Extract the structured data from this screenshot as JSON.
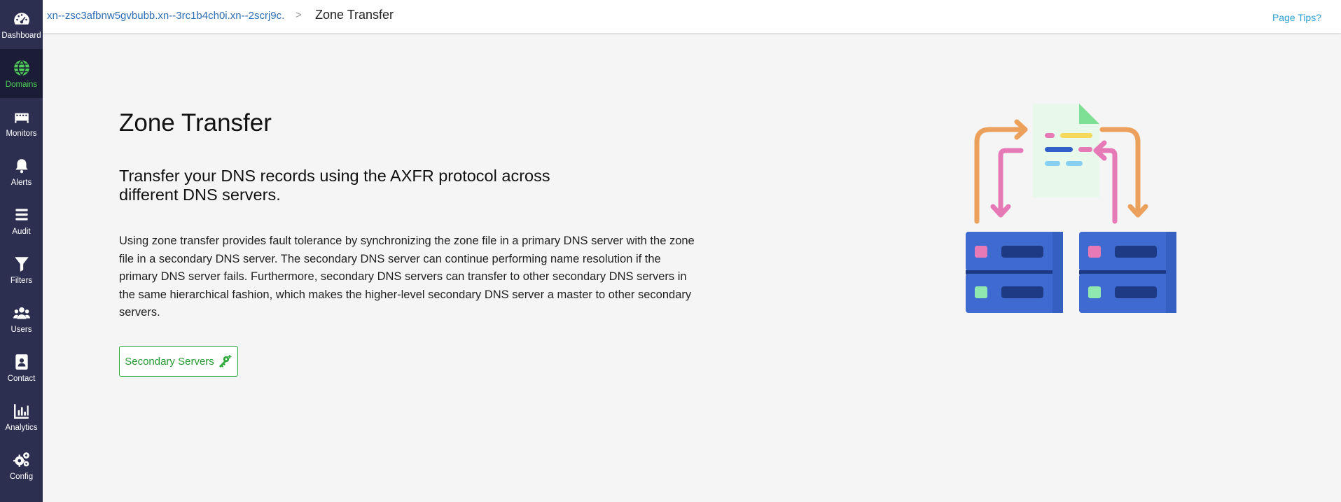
{
  "sidebar": {
    "items": [
      {
        "label": "Dashboard",
        "icon": "speedometer-icon",
        "active": false
      },
      {
        "label": "Domains",
        "icon": "globe-icon",
        "active": true
      },
      {
        "label": "Monitors",
        "icon": "monitor-icon",
        "active": false
      },
      {
        "label": "Alerts",
        "icon": "bell-icon",
        "active": false
      },
      {
        "label": "Audit",
        "icon": "audit-list-icon",
        "active": false
      },
      {
        "label": "Filters",
        "icon": "filter-icon",
        "active": false
      },
      {
        "label": "Users",
        "icon": "users-icon",
        "active": false
      },
      {
        "label": "Contact",
        "icon": "contact-card-icon",
        "active": false
      },
      {
        "label": "Analytics",
        "icon": "bar-chart-icon",
        "active": false
      },
      {
        "label": "Config",
        "icon": "gears-icon",
        "active": false
      }
    ]
  },
  "header": {
    "breadcrumb_domain": "xn--zsc3afbnw5gvbubb.xn--3rc1b4ch0i.xn--2scrj9c.",
    "breadcrumb_separator": ">",
    "breadcrumb_current": "Zone Transfer",
    "page_tips": "Page Tips?"
  },
  "main": {
    "title": "Zone Transfer",
    "subtitle": "Transfer your DNS records using the AXFR protocol across different DNS servers.",
    "description": "Using zone transfer provides fault tolerance by synchronizing the zone file in a primary DNS server with the zone file in a secondary DNS server. The secondary DNS server can continue performing name resolution if the primary DNS server fails. Furthermore, secondary DNS servers can transfer to other secondary DNS servers in the same hierarchical fashion, which makes the higher-level secondary DNS server a master to other secondary servers.",
    "button_label": "Secondary Servers",
    "button_icon": "key-plus-icon",
    "illustration": "zone-transfer-illustration"
  },
  "colors": {
    "sidebar_bg": "#2d2f50",
    "sidebar_active_bg": "#1b1c35",
    "active_accent": "#4fd05a",
    "link": "#2e6fb7",
    "page_tips": "#2a9fd6",
    "button_green": "#2eaa3a"
  }
}
